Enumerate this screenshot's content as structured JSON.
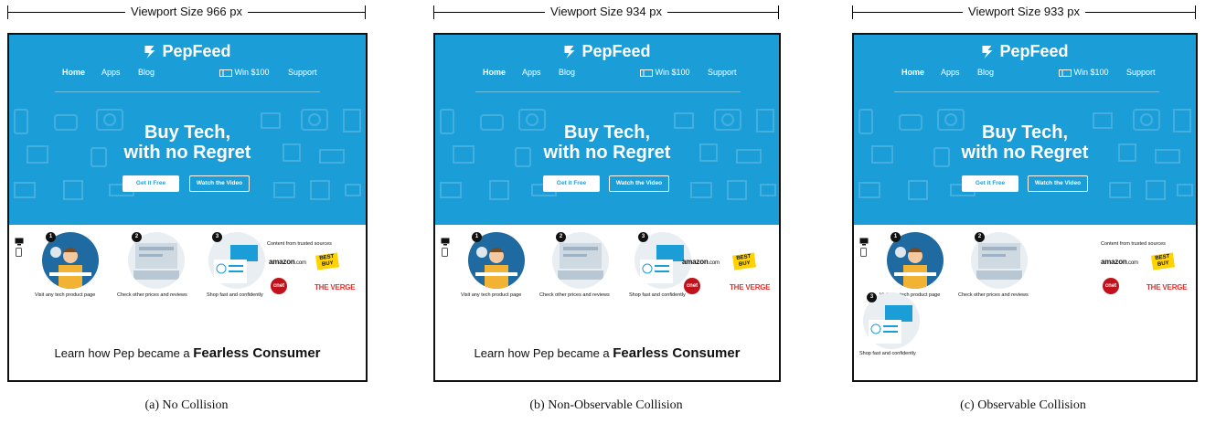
{
  "panels": [
    {
      "viewport_label": "Viewport Size 966 px",
      "caption": "(a) No Collision"
    },
    {
      "viewport_label": "Viewport Size 934 px",
      "caption": "(b) Non-Observable Collision"
    },
    {
      "viewport_label": "Viewport Size 933 px",
      "caption": "(c) Observable Collision"
    }
  ],
  "site": {
    "brand": "PepFeed",
    "nav": {
      "home": "Home",
      "apps": "Apps",
      "blog": "Blog",
      "win": "Win $100",
      "support": "Support"
    },
    "headline_line1": "Buy Tech,",
    "headline_line2": "with no Regret",
    "cta_primary": "Get it Free",
    "cta_secondary": "Watch the Video",
    "steps": [
      {
        "number": "1",
        "caption": "Visit any tech product page"
      },
      {
        "number": "2",
        "caption": "Check other prices and reviews"
      },
      {
        "number": "3",
        "caption": "Shop fast and confidently"
      }
    ],
    "sources_label": "Content from trusted sources",
    "source_logos": {
      "amazon": "amazon",
      "amazon_suffix": ".com",
      "bestbuy_line1": "BEST",
      "bestbuy_line2": "BUY",
      "cnet": "cnet",
      "verge": "THE VERGE"
    },
    "learn_prefix": "Learn how Pep became a ",
    "learn_bold": "Fearless Consumer"
  },
  "colors": {
    "hero_blue": "#1b9ed8",
    "bestbuy_yellow": "#ffd200",
    "cnet_red": "#c1121b",
    "verge_red": "#e2312d"
  },
  "icons": [
    "pepfeed-logo-icon",
    "gift-card-icon",
    "desktop-icon",
    "mobile-icon",
    "step-illustration"
  ]
}
